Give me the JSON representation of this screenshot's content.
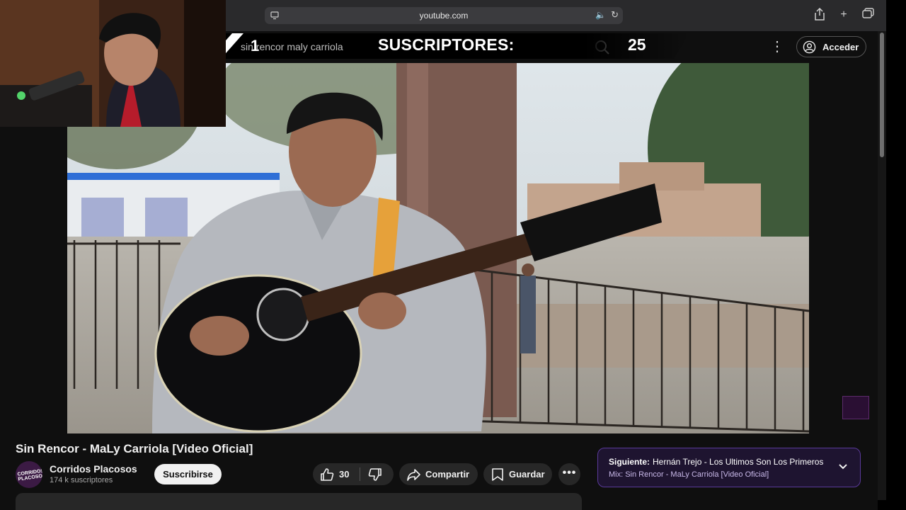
{
  "browser": {
    "url": "youtube.com"
  },
  "search": {
    "query": "sin rencor maly carriola"
  },
  "header": {
    "signin_label": "Acceder"
  },
  "overlay": {
    "number": "1",
    "subscribers_label": "SUSCRIPTORES:",
    "subscribers_count": "25"
  },
  "video": {
    "title": "Sin Rencor - MaLy Carriola [Video Oficial]"
  },
  "channel": {
    "name": "Corridos Placosos",
    "subscribers": "174 k suscriptores",
    "subscribe_label": "Suscribirse",
    "avatar_text": "CORRIDOS PLACOSOS"
  },
  "actions": {
    "like_count": "30",
    "share_label": "Compartir",
    "save_label": "Guardar"
  },
  "next": {
    "label": "Siguiente:",
    "title": "Hernán Trejo - Los Ultimos Son Los Primeros",
    "mix": "Mix: Sin Rencor - MaLy Carriola [Video Oficial]"
  },
  "colors": {
    "accent_purple": "#5a3a9a",
    "speaker_blue": "#4ea1ff",
    "page_bg": "#0f0f0f"
  }
}
